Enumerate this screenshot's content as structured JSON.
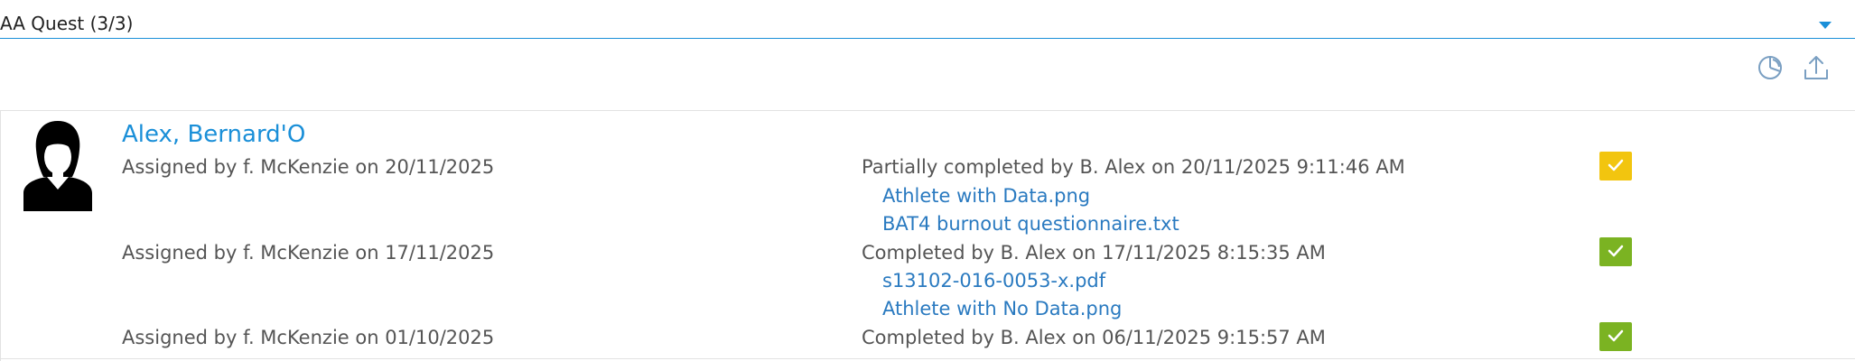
{
  "select": {
    "value": "AA Quest (3/3)",
    "caret_icon": "caret-down-icon",
    "accent": "#1a8fd8"
  },
  "toolbar": {
    "chart_icon": "pie-chart-icon",
    "export_icon": "upload-icon"
  },
  "athlete": {
    "name": "Alex, Bernard'O",
    "avatar_icon": "person-silhouette-icon"
  },
  "assignments": [
    {
      "assigned": "Assigned by f. McKenzie on 20/11/2025",
      "completion": "Partially completed by B. Alex on 20/11/2025 9:11:46 AM",
      "files": [
        "Athlete with Data.png",
        "BAT4 burnout questionnaire.txt"
      ],
      "status": "partial",
      "status_color": "#f2c50f",
      "status_icon": "checkmark-icon"
    },
    {
      "assigned": "Assigned by f. McKenzie on 17/11/2025",
      "completion": "Completed by B. Alex on 17/11/2025 8:15:35 AM",
      "files": [
        "s13102-016-0053-x.pdf",
        "Athlete with No Data.png"
      ],
      "status": "complete",
      "status_color": "#7bb322",
      "status_icon": "checkmark-icon"
    },
    {
      "assigned": "Assigned by f. McKenzie on 01/10/2025",
      "completion": "Completed by B. Alex on 06/11/2025 9:15:57 AM",
      "files": [],
      "status": "complete",
      "status_color": "#7bb322",
      "status_icon": "checkmark-icon"
    }
  ]
}
